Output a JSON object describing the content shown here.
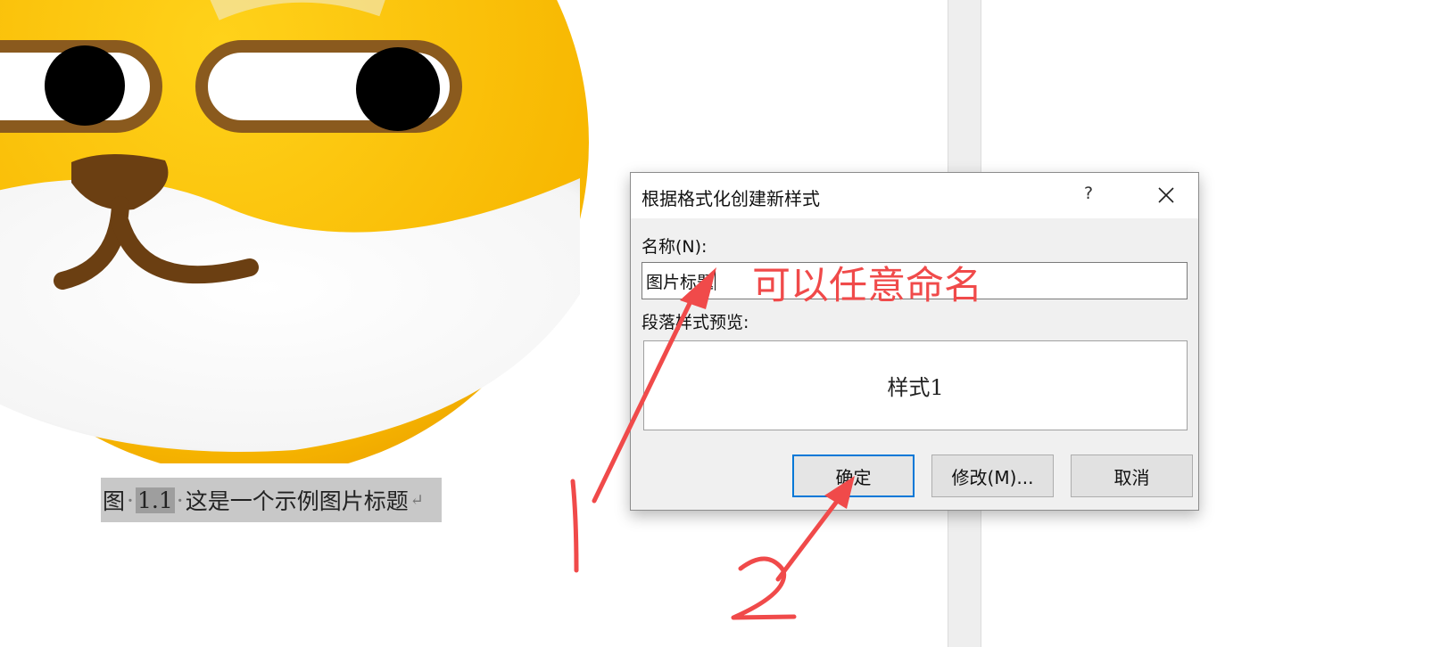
{
  "document": {
    "caption": {
      "prefix": "图",
      "number": "1.1",
      "text": "这是一个示例图片标题",
      "dot": "·",
      "return_mark": "↵"
    }
  },
  "dialog": {
    "title": "根据格式化创建新样式",
    "help_label": "?",
    "name_label": "名称(N):",
    "name_value": "图片标题",
    "preview_label": "段落样式预览:",
    "preview_text": "样式1",
    "buttons": {
      "ok": "确定",
      "modify": "修改(M)...",
      "cancel": "取消"
    }
  },
  "annotations": {
    "note": "可以任意命名",
    "step1": "1",
    "step2": "2",
    "color": "#f04a4a"
  },
  "icons": [
    "close-icon",
    "help-icon",
    "arrow-annotation-icon"
  ]
}
